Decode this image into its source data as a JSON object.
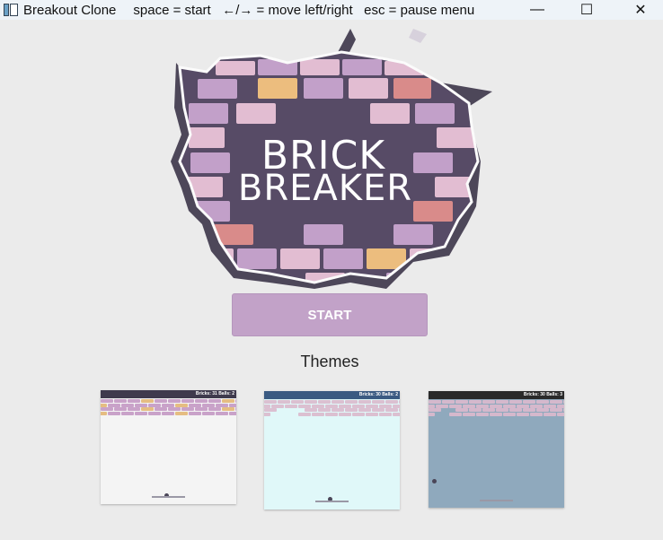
{
  "window": {
    "title": "Breakout Clone",
    "hints": "space = start   ←/→ = move left/right   esc = pause menu",
    "minimize_glyph": "—",
    "maximize_glyph": "☐",
    "close_glyph": "✕"
  },
  "logo": {
    "line1": "BRICK",
    "line2": "BREAKER"
  },
  "start_button": {
    "label": "START"
  },
  "themes": {
    "label": "Themes",
    "items": [
      {
        "status": "Bricks: 31 Balls: 2",
        "header_color": "#3f3a4d",
        "bg_color": "#f4f4f4",
        "brick_colors": [
          "#c9a2c9",
          "#e5bd82"
        ]
      },
      {
        "status": "Bricks: 30 Balls: 2",
        "header_color": "#3a5a82",
        "bg_color": "#e0f8f9",
        "brick_colors": [
          "#dbc0d1"
        ]
      },
      {
        "status": "Bricks: 30 Balls: 3",
        "header_color": "#2a2a2a",
        "bg_color": "#8fa9bd",
        "brick_colors": [
          "#d5b8cc"
        ]
      }
    ]
  },
  "colors": {
    "accent": "#c2a2c8",
    "background": "#ebebeb"
  }
}
